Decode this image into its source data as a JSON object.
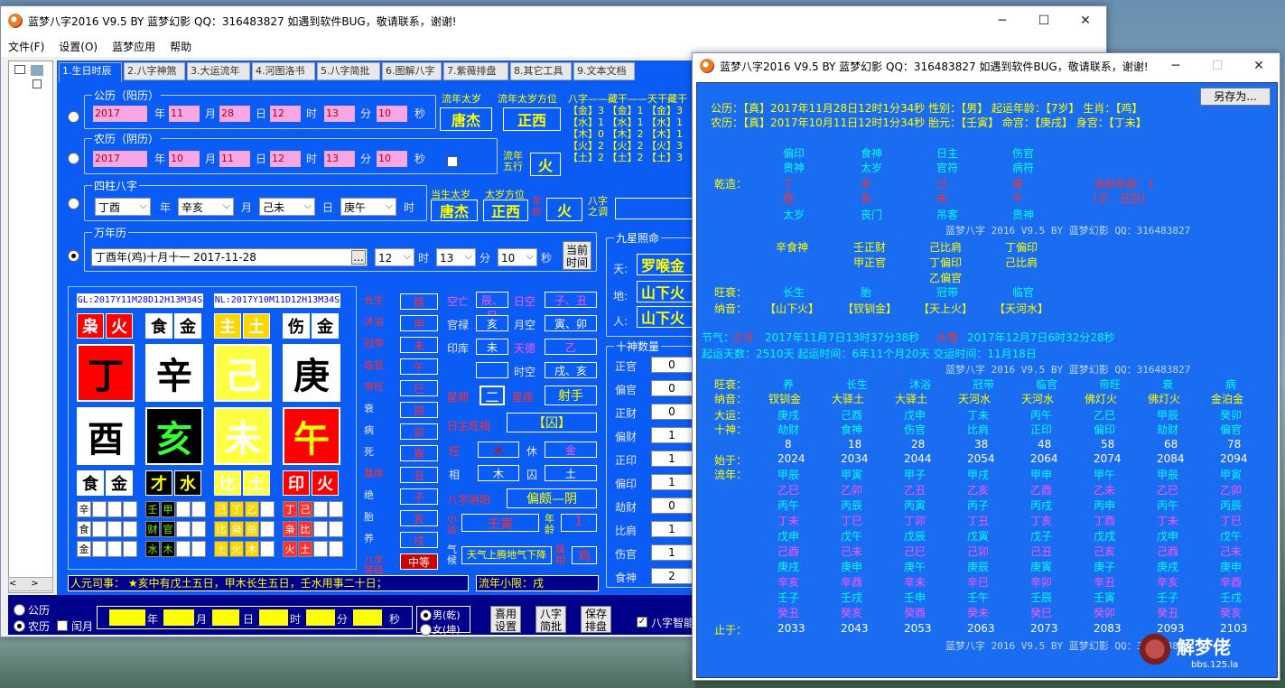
{
  "main_window": {
    "title": "蓝梦八字2016 V9.5 BY 蓝梦幻影 QQ：316483827  如遇到软件BUG，敬请联系，谢谢!",
    "menu": [
      "文件(F)",
      "设置(O)",
      "蓝梦应用",
      "帮助"
    ],
    "tabs": [
      "1.生日时辰",
      "2.八字神煞",
      "3.大运流年",
      "4.河图洛书",
      "5.八字简批",
      "6.图解八字",
      "7.紫薇排盘",
      "8.其它工具",
      "9.文本文档"
    ],
    "solar": {
      "group": "公历（阳历）",
      "year": "2017",
      "month": "11",
      "day": "28",
      "hour": "12",
      "minute": "13",
      "second": "10",
      "u_year": "年",
      "u_month": "月",
      "u_day": "日",
      "u_hour": "时",
      "u_minute": "分",
      "u_second": "秒"
    },
    "lunar": {
      "group": "农历（阴历）",
      "year": "2017",
      "month": "10",
      "day": "11",
      "hour": "12",
      "minute": "13",
      "second": "10"
    },
    "sizhu": {
      "group": "四柱八字",
      "year": "丁酉",
      "month": "辛亥",
      "day": "己未",
      "hour": "庚午",
      "u_year": "年",
      "u_month": "月",
      "u_day": "日",
      "u_hour": "时"
    },
    "wannianli": {
      "group": "万年历",
      "value": "丁酉年(鸡)十月十一  2017-11-28",
      "hour": "12",
      "minute": "13",
      "second": "10",
      "now_btn": "当前时间",
      "dots": "..."
    },
    "liunian": {
      "taisui_label": "流年太岁",
      "taisui": "唐杰",
      "fangwei_label": "流年太岁方位",
      "fangwei": "正西"
    },
    "five": {
      "label": "流年五行",
      "value": "火"
    },
    "dangsheng": {
      "taisui_label": "当生太岁",
      "taisui": "唐杰",
      "fangwei_label": "太岁方位",
      "fangwei": "正西",
      "nianming_label": "年命",
      "nianming": "火",
      "bazi_label": "八字之调"
    },
    "cangan_header": "八字——藏干——天干藏干",
    "cangan_rows": [
      "【金】3 【金】1 【金】3",
      "【水】1 【水】1 【水】1",
      "【木】0 【木】2 【木】1",
      "【火】2 【火】2 【火】3",
      "【土】2 【土】2 【土】3"
    ],
    "jiuxing": {
      "group": "九星照命",
      "tian_label": "天:",
      "tian": "罗喉金",
      "di_label": "地:",
      "di": "山下火",
      "ren_label": "人:",
      "ren": "山下火"
    },
    "chart": {
      "gl": "GL:2017Y11M28D12H13M34S",
      "nl": "NL:2017Y10M11D12H13M34S",
      "top": [
        [
          "枭",
          "火"
        ],
        [
          "食",
          "金"
        ],
        [
          "主",
          "土"
        ],
        [
          "伤",
          "金"
        ]
      ],
      "gan": [
        "丁",
        "辛",
        "己",
        "庚"
      ],
      "zhi": [
        "酉",
        "亥",
        "未",
        "午"
      ],
      "bottom": [
        [
          "食",
          "金"
        ],
        [
          "才",
          "水"
        ],
        [
          "比",
          "土"
        ],
        [
          "印",
          "火"
        ]
      ],
      "cang": [
        [
          "辛",
          "",
          "",
          ""
        ],
        [
          "食",
          "",
          "",
          ""
        ],
        [
          "金",
          "",
          "",
          ""
        ],
        [
          "壬",
          "甲",
          "",
          ""
        ],
        [
          "财",
          "官",
          "",
          ""
        ],
        [
          "水",
          "木",
          "",
          ""
        ],
        [
          "己",
          "丁",
          "乙",
          ""
        ],
        [
          "比",
          "枭",
          "杀",
          ""
        ],
        [
          "土",
          "火",
          "木",
          ""
        ],
        [
          "丁",
          "己",
          "",
          ""
        ],
        [
          "枭",
          "比",
          "",
          ""
        ],
        [
          "火",
          "土",
          "",
          ""
        ]
      ]
    },
    "cs": {
      "labels": [
        "长生",
        "沐浴",
        "冠带",
        "临官",
        "帝旺",
        "衰",
        "病",
        "死",
        "墓库",
        "绝",
        "胎",
        "养",
        "八字等级"
      ],
      "values": [
        "酉",
        "申",
        "未",
        "午",
        "巳",
        "辰",
        "卯",
        "寅",
        "丑",
        "子",
        "亥",
        "戌",
        "中等"
      ]
    },
    "mid": {
      "kongwang": "空亡",
      "kw_val": "辰、巳",
      "guanlu": "官禄",
      "gl_val": "亥",
      "yuekong": "月空",
      "yk_val": "寅、卯",
      "yinku": "印库",
      "yk2": "未",
      "rikong": "日空",
      "rk_val": "子、丑",
      "tiande": "天德",
      "td_val": "乙",
      "shikong": "时空",
      "sk_val": "戌、亥",
      "xingqi": "星期",
      "xq_val": "二",
      "xingzuo": "星座",
      "xz_val": "射手",
      "wangxiang": "日主旺相",
      "wx_val": "【囚】",
      "wang": "旺",
      "wang_v": "水",
      "xiu": "休",
      "xiu_v": "金",
      "xiang": "相",
      "xiang_v": "木",
      "qiu": "囚",
      "qiu_v": "土",
      "yinyang": "八字阴阳",
      "yy_val": "偏颇—阴",
      "xiaoyun": "小运",
      "xy_val": "壬寅",
      "nianling": "年龄",
      "nl_val": "1",
      "qixiang": "气候",
      "qx_val": "天气上腾地气下降",
      "shuxiang": "属相",
      "sx_val": "鸡"
    },
    "shishen": {
      "group": "十神数量",
      "labels": [
        "正官",
        "偏官",
        "正财",
        "偏财",
        "正印",
        "偏印",
        "劫财",
        "比肩",
        "伤官",
        "食神"
      ],
      "values": [
        "0",
        "0",
        "0",
        "1",
        "1",
        "1",
        "0",
        "1",
        "1",
        "2"
      ]
    },
    "renyuan": "人元司事：  ★亥中有戊土五日，甲木长生五日，壬水用事二十日；",
    "liunian_xx": "流年小限：戌",
    "bottom": {
      "gongli": "公历",
      "nongli": "农历",
      "runyue": "闰月",
      "nian": "年",
      "yue": "月",
      "ri": "日",
      "shi": "时",
      "fen": "分",
      "miao": "秒",
      "male": "男(乾)",
      "female": "女(坤)",
      "btn1": "喜用设置",
      "btn2": "八字简批",
      "btn3": "保存排盘",
      "zhineng": "八字智能"
    }
  },
  "report_window": {
    "title": "蓝梦八字2016 V9.5 BY 蓝梦幻影 QQ：316483827  如遇到软件BUG，敬请联系，谢谢!",
    "saveas": "另存为...",
    "line1": "公历：【真】2017年11月28日12时1分34秒  性别：【男】  起运年龄：【7岁】  生肖：【鸡】",
    "line2": "农历：【真】2017年10月11日12时1分34秒  胎元：【壬寅】  命宫：【庚戌】  身宫：【丁未】",
    "qianzao": "乾造：",
    "cols": [
      [
        "偏印",
        "贵神",
        "丁",
        "酉",
        "太岁"
      ],
      [
        "食神",
        "太岁",
        "辛",
        "亥",
        "丧门"
      ],
      [
        "日主",
        "官符",
        "己",
        "未",
        "吊客"
      ],
      [
        "伤官",
        "病符",
        "庚",
        "午",
        "贵神"
      ]
    ],
    "age": "当前年龄：1",
    "kong": "(子、丑空)",
    "watermark": "蓝梦八字 2016 V9.5  BY 蓝梦幻影 QQ：316483827",
    "cang": [
      [
        "辛食神"
      ],
      [
        "壬正财",
        "甲正官"
      ],
      [
        "己比肩",
        "丁偏印",
        "乙偏官"
      ],
      [
        "丁偏印",
        "己比肩"
      ]
    ],
    "wangshuai": "旺衰：",
    "ws": [
      "长生",
      "胎",
      "冠带",
      "临官"
    ],
    "nayin": "纳音：",
    "ny": [
      "【山下火】",
      "【钗钏金】",
      "【天上火】",
      "【天河水】"
    ],
    "jieqi1_l": "节气：",
    "jieqi1": "立冬",
    "jieqi1_t": "2017年11月7日13时37分38秒",
    "jieqi2": "大雪",
    "jieqi2_t": "2017年12月7日6时32分28秒",
    "qiyun": "起运天数：2510天    起运时间：6年11个月20天     交运时间：11月18日",
    "dy_labels": [
      "旺衰：",
      "纳音：",
      "大运：",
      "十神：",
      "",
      "始于：",
      "流年："
    ],
    "dy": [
      {
        "ws": "养",
        "ny": "钗钏金",
        "dy": "庚戌",
        "ss": "劫财",
        "age": "8",
        "start": "2024",
        "ln": [
          "甲辰",
          "乙巳",
          "丙午",
          "丁未",
          "戊申",
          "己酉",
          "庚戌",
          "辛亥",
          "壬子",
          "癸丑"
        ],
        "end": "2033"
      },
      {
        "ws": "长生",
        "ny": "大驿土",
        "dy": "己酉",
        "ss": "食神",
        "age": "18",
        "start": "2034",
        "ln": [
          "甲寅",
          "乙卯",
          "丙辰",
          "丁巳",
          "戊午",
          "己未",
          "庚申",
          "辛酉",
          "壬戌",
          "癸亥"
        ],
        "end": "2043"
      },
      {
        "ws": "沐浴",
        "ny": "大驿土",
        "dy": "戊申",
        "ss": "伤官",
        "age": "28",
        "start": "2044",
        "ln": [
          "甲子",
          "乙丑",
          "丙寅",
          "丁卯",
          "戊辰",
          "己巳",
          "庚午",
          "辛未",
          "壬申",
          "癸酉"
        ],
        "end": "2053"
      },
      {
        "ws": "冠带",
        "ny": "天河水",
        "dy": "丁未",
        "ss": "比肩",
        "age": "38",
        "start": "2054",
        "ln": [
          "甲戌",
          "乙亥",
          "丙子",
          "丁丑",
          "戊寅",
          "己卯",
          "庚辰",
          "辛巳",
          "壬午",
          "癸未"
        ],
        "end": "2063"
      },
      {
        "ws": "临官",
        "ny": "天河水",
        "dy": "丙午",
        "ss": "正印",
        "age": "48",
        "start": "2064",
        "ln": [
          "甲申",
          "乙酉",
          "丙戌",
          "丁亥",
          "戊子",
          "己丑",
          "庚寅",
          "辛卯",
          "壬辰",
          "癸巳"
        ],
        "end": "2073"
      },
      {
        "ws": "帝旺",
        "ny": "佛灯火",
        "dy": "乙巳",
        "ss": "偏印",
        "age": "58",
        "start": "2074",
        "ln": [
          "甲午",
          "乙未",
          "丙申",
          "丁酉",
          "戊戌",
          "己亥",
          "庚子",
          "辛丑",
          "壬寅",
          "癸卯"
        ],
        "end": "2083"
      },
      {
        "ws": "衰",
        "ny": "佛灯火",
        "dy": "甲辰",
        "ss": "劫财",
        "age": "68",
        "start": "2084",
        "ln": [
          "甲辰",
          "乙巳",
          "丙午",
          "丁未",
          "戊申",
          "己酉",
          "庚戌",
          "辛亥",
          "壬子",
          "癸丑"
        ],
        "end": "2093"
      },
      {
        "ws": "病",
        "ny": "金泊金",
        "dy": "癸卯",
        "ss": "偏官",
        "age": "78",
        "start": "2094",
        "ln": [
          "甲寅",
          "乙卯",
          "丙辰",
          "丁巳",
          "戊午",
          "己未",
          "庚申",
          "辛酉",
          "壬戌",
          "癸亥"
        ],
        "end": "2103"
      }
    ],
    "zhiyu": "止于：",
    "site": "解梦佬",
    "site_url": "bbs.125.la"
  }
}
